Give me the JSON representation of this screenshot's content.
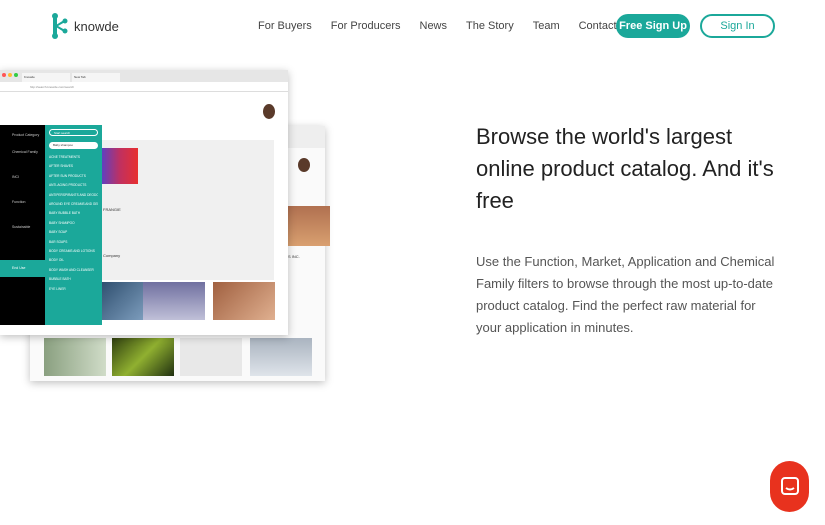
{
  "nav": {
    "brand": "knowde",
    "links": [
      "For Buyers",
      "For Producers",
      "News",
      "The Story",
      "Team",
      "Contact"
    ],
    "signup": "Free Sign Up",
    "signin": "Sign In"
  },
  "hero": {
    "title": "Browse the world's largest online product catalog. And it's free",
    "text": "Use the Function, Market, Application and Chemical Family filters to browse through the most up-to-date product catalog. Find the perfect raw material for your application in minutes."
  },
  "mock": {
    "tabs": [
      "Knowde",
      "New Tab"
    ],
    "url": "http://search.knowde.com/search",
    "search_placeholder": "Start search",
    "select_label": "Baby shampoo",
    "sidebar": [
      "Product Category",
      "Chemical Family",
      "INCI",
      "Function",
      "Sustainable",
      "End Use"
    ],
    "menu_items": [
      "ACNE TREATMENTS",
      "AFTER SHAVES",
      "AFTER SUN PRODUCTS",
      "ANTI-AGING PRODUCTS",
      "ANTIPERSPIRANTS AND DEODORANTS",
      "AROUND EYE CREAMS AND GELS",
      "BABY BUBBLE BATH",
      "BABY SHAMPOO",
      "BABY SOAP",
      "BAR SOAPS",
      "BODY CREAMS AND LOTIONS",
      "BODY OIL",
      "BODY WASH AND CLEANSER",
      "BUBBLE BATH",
      "EYE LINER"
    ],
    "card_text": [
      "FRANGIE",
      "Company",
      "S INC."
    ]
  },
  "colors": {
    "brand": "#1ba89a",
    "chat": "#e8321e"
  }
}
